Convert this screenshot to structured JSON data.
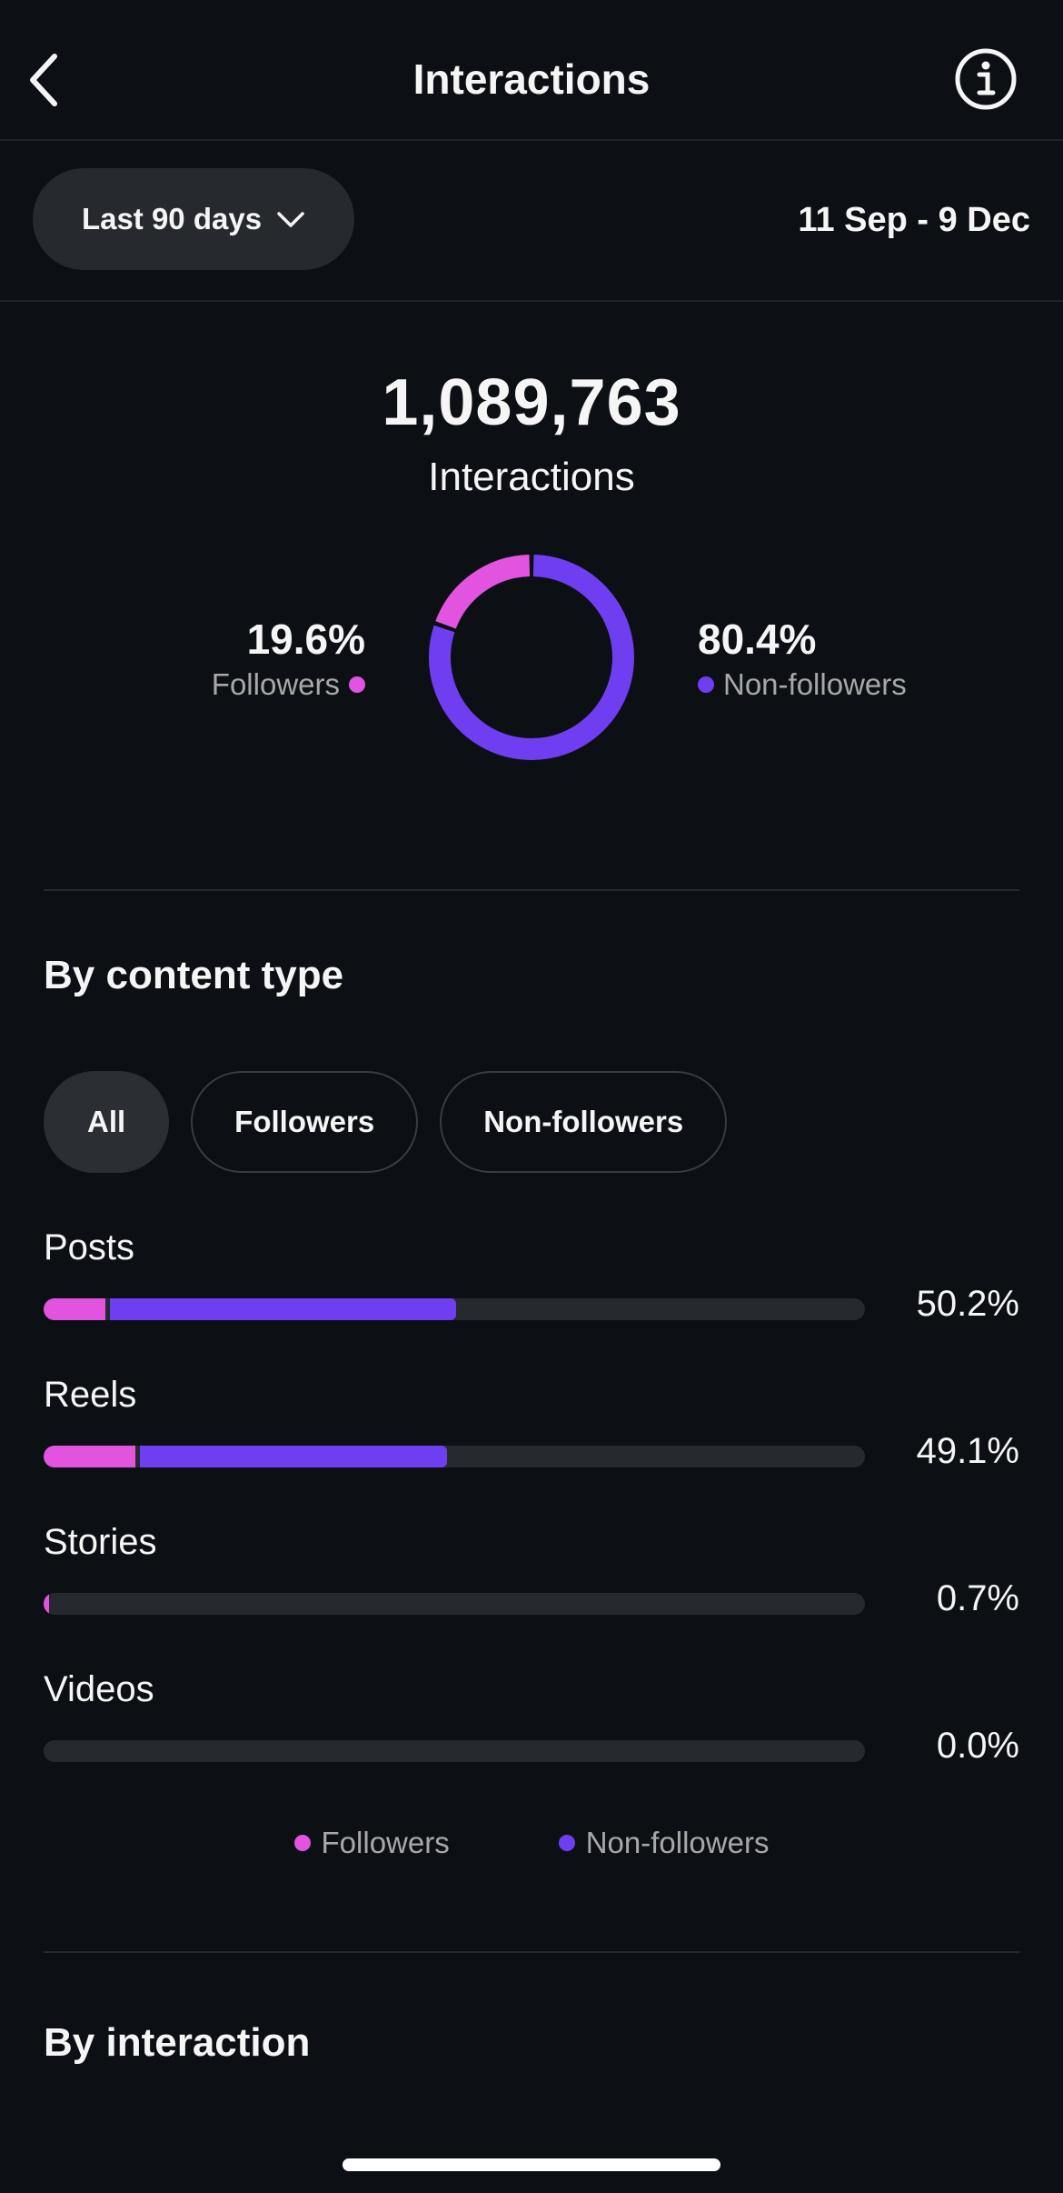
{
  "header": {
    "title": "Interactions",
    "back_icon": "chevron-left-icon",
    "info_icon": "info-icon"
  },
  "filter": {
    "range_label": "Last 90 days",
    "dropdown_icon": "chevron-down-icon",
    "date_range": "11 Sep - 9 Dec"
  },
  "summary": {
    "total": "1,089,763",
    "total_label": "Interactions",
    "followers_pct": "19.6%",
    "followers_label": "Followers",
    "nonfollowers_pct": "80.4%",
    "nonfollowers_label": "Non-followers"
  },
  "colors": {
    "followers": "#e254e0",
    "nonfollowers": "#6f3ef0",
    "track": "#26292e",
    "background": "#0c1014"
  },
  "chart_data": [
    {
      "type": "pie",
      "variant": "donut",
      "categories": [
        "Followers",
        "Non-followers"
      ],
      "values": [
        19.6,
        80.4
      ]
    },
    {
      "type": "bar",
      "orientation": "horizontal",
      "stacked": true,
      "categories": [
        "Posts",
        "Reels",
        "Stories",
        "Videos"
      ],
      "totals": [
        50.2,
        49.1,
        0.7,
        0.0
      ],
      "series": [
        {
          "name": "Followers",
          "values": [
            7.5,
            11.2,
            0.7,
            0.0
          ]
        },
        {
          "name": "Non-followers",
          "values": [
            42.7,
            37.9,
            0.0,
            0.0
          ]
        }
      ],
      "xlim": [
        0,
        100
      ],
      "legend": "bottom"
    }
  ],
  "content_type": {
    "title": "By content type",
    "tabs": [
      "All",
      "Followers",
      "Non-followers"
    ],
    "active_tab": "All",
    "rows": [
      {
        "label": "Posts",
        "pct": "50.2%"
      },
      {
        "label": "Reels",
        "pct": "49.1%"
      },
      {
        "label": "Stories",
        "pct": "0.7%"
      },
      {
        "label": "Videos",
        "pct": "0.0%"
      }
    ],
    "legend": [
      "Followers",
      "Non-followers"
    ]
  },
  "interaction": {
    "title": "By interaction"
  }
}
